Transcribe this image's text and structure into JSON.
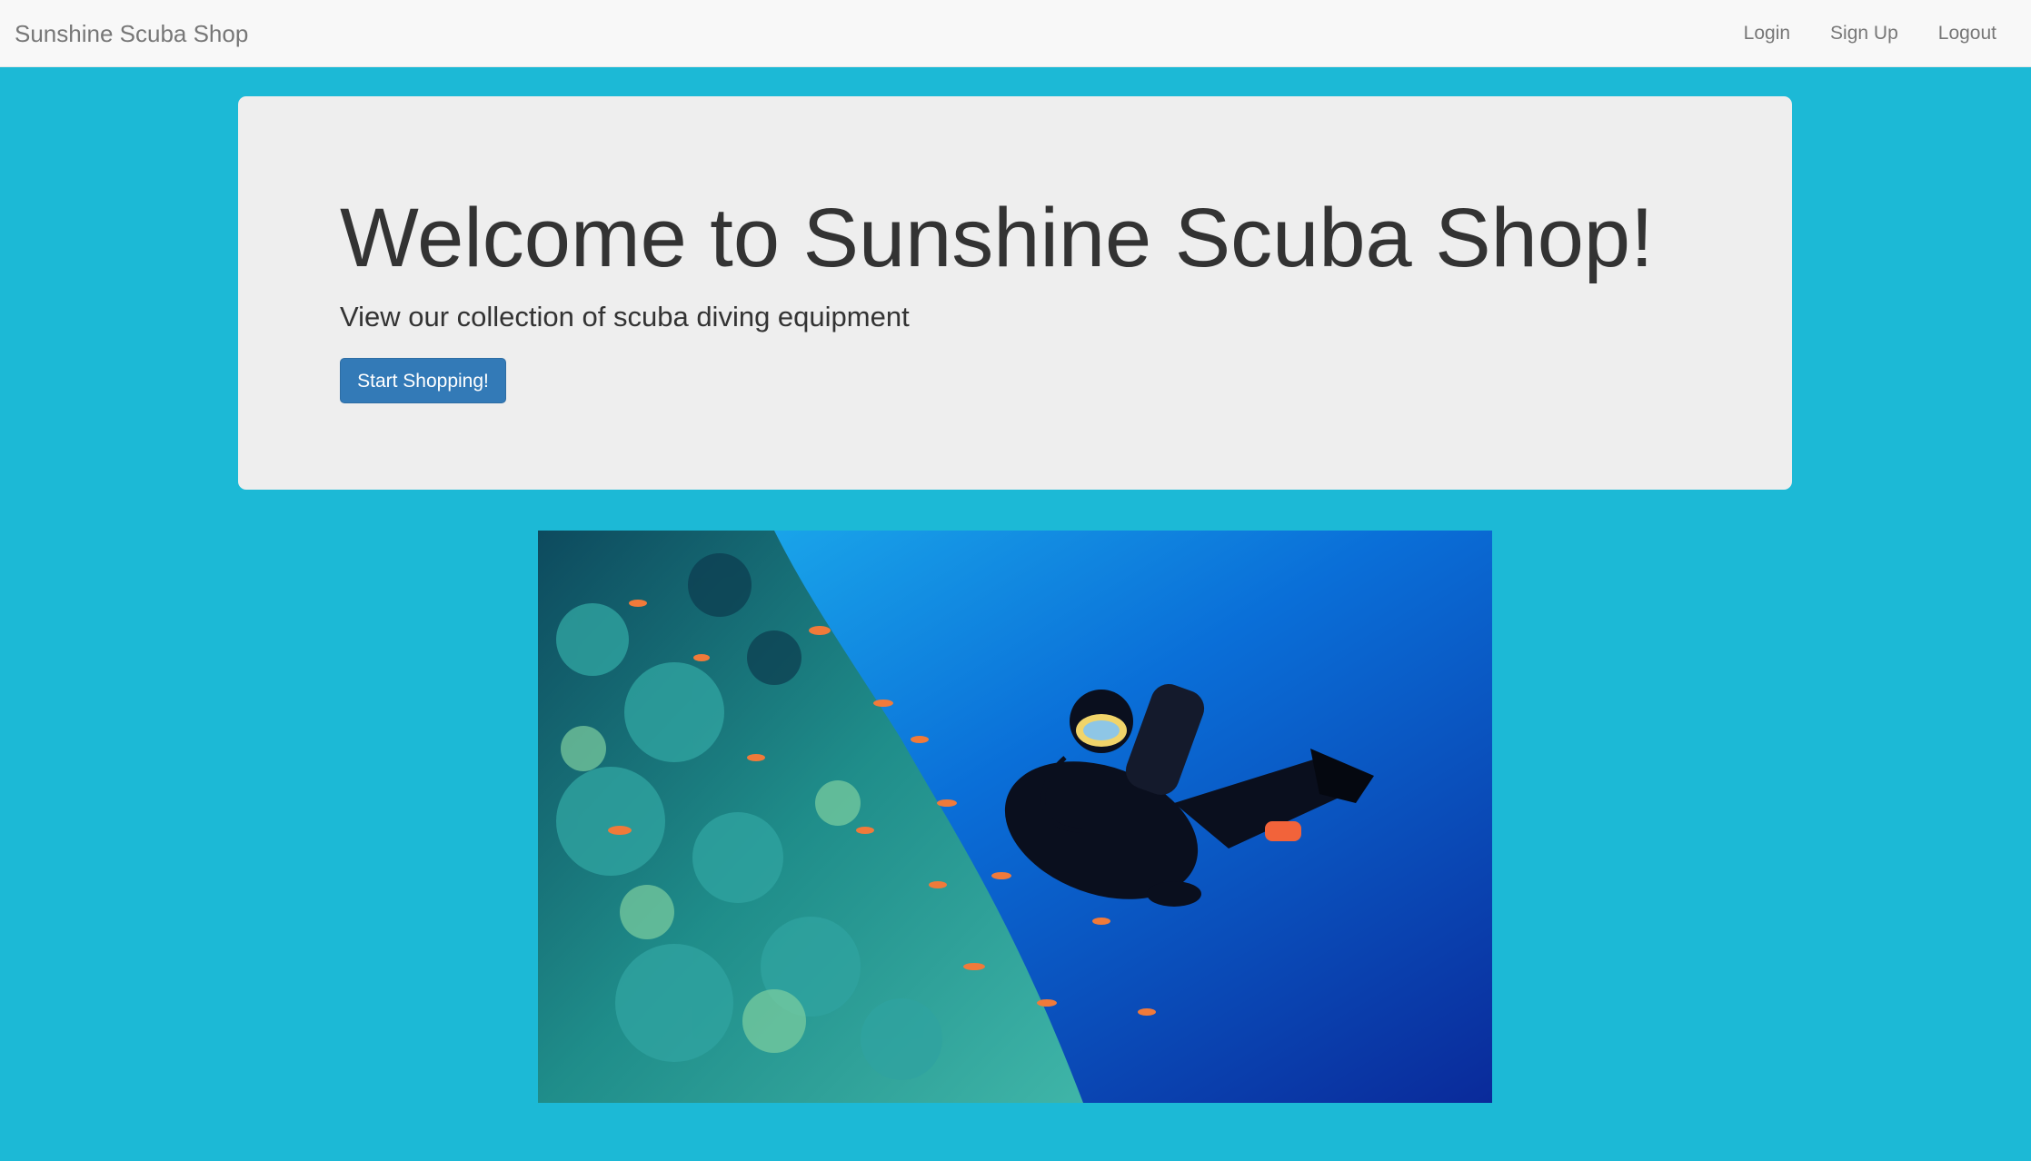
{
  "navbar": {
    "brand": "Sunshine Scuba Shop",
    "links": [
      {
        "label": "Login"
      },
      {
        "label": "Sign Up"
      },
      {
        "label": "Logout"
      }
    ]
  },
  "jumbotron": {
    "title": "Welcome to Sunshine Scuba Shop!",
    "subtitle": "View our collection of scuba diving equipment",
    "button_label": "Start Shopping!"
  },
  "hero_image": {
    "subject": "scuba-diver-coral-reef-photo"
  },
  "colors": {
    "page_background": "#1cb9d6",
    "navbar_background": "#f8f8f8",
    "jumbotron_background": "#eeeeee",
    "primary_button": "#337ab7",
    "nav_text": "#777777",
    "heading_text": "#333333"
  }
}
